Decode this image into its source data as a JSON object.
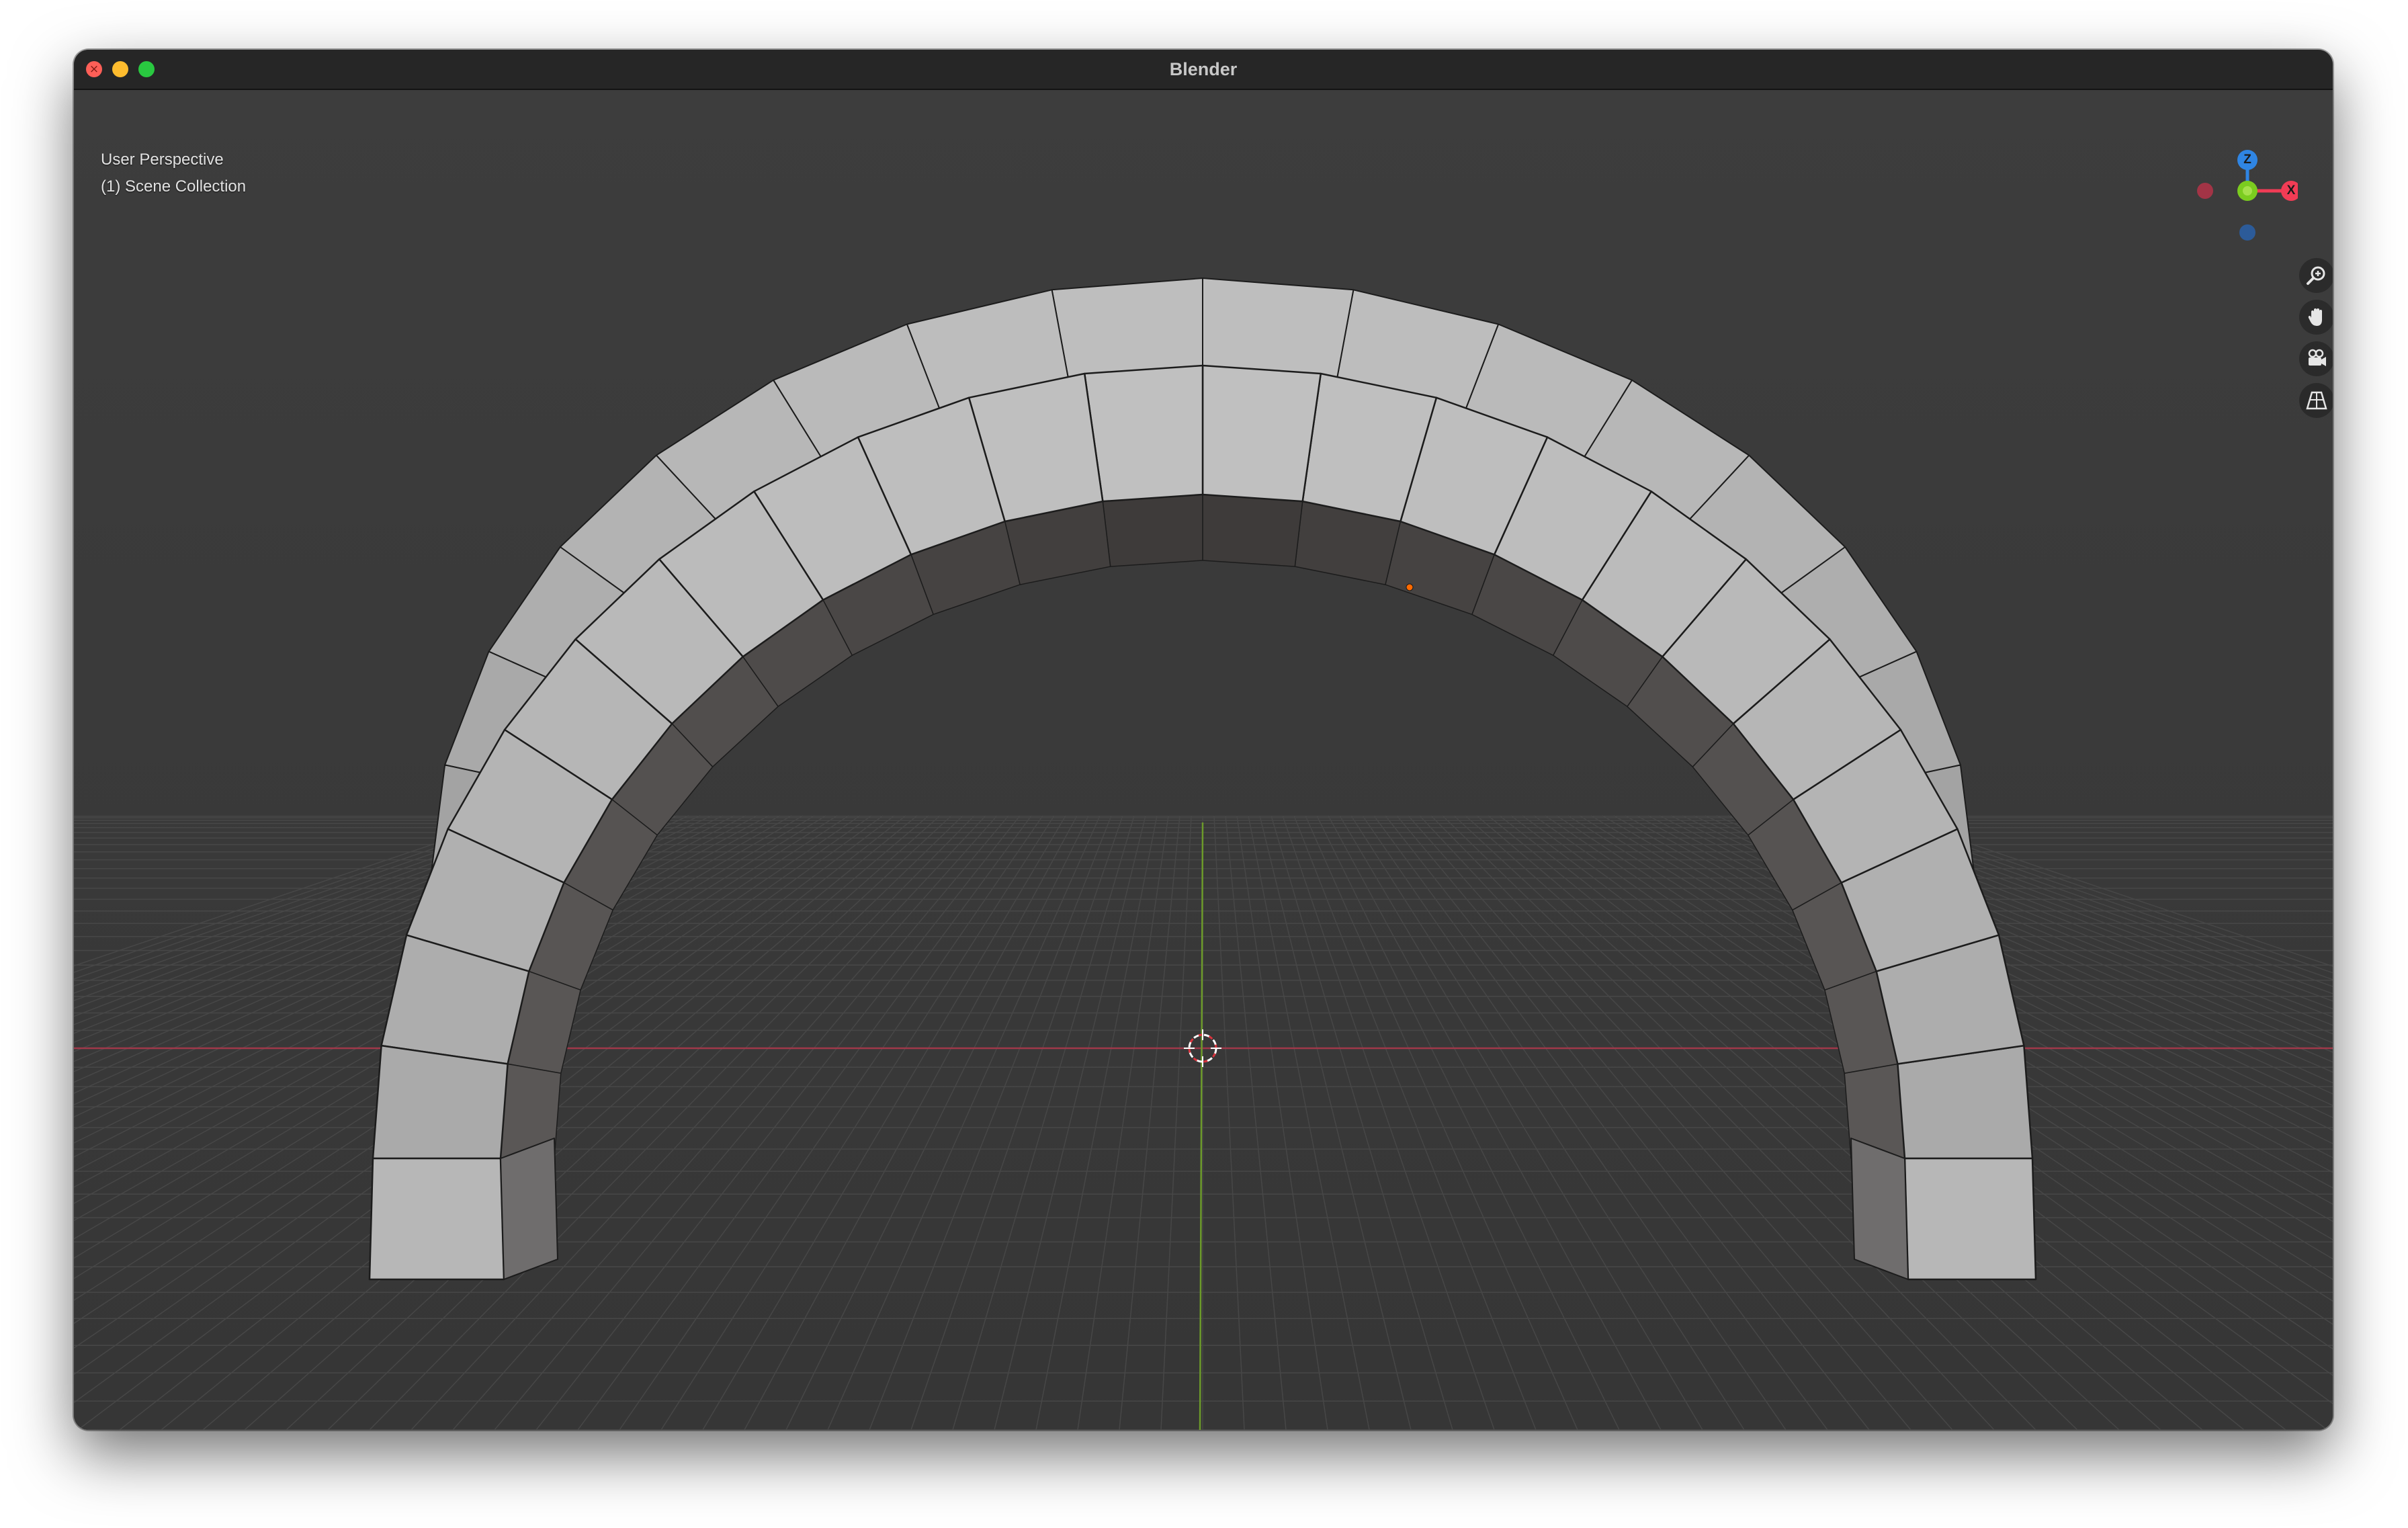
{
  "window": {
    "title": "Blender"
  },
  "viewport": {
    "view_name": "User Perspective",
    "collection": "(1) Scene Collection"
  },
  "gizmo": {
    "z_label": "Z",
    "x_label": "X",
    "colors": {
      "x": "#f13c55",
      "y": "#7bcc1f",
      "z": "#2f85e3"
    }
  },
  "navigation_icons": [
    "zoom-icon",
    "hand-pan-icon",
    "camera-icon",
    "perspective-grid-icon"
  ],
  "colors": {
    "background": "#3a3a3a",
    "titlebar": "#262626",
    "mesh_light": "#b9b9b9",
    "mesh_dark": "#4a4646",
    "x_axis": "#a0384a",
    "y_axis": "#6c9a2a",
    "origin_marker": "#ff6a00"
  }
}
